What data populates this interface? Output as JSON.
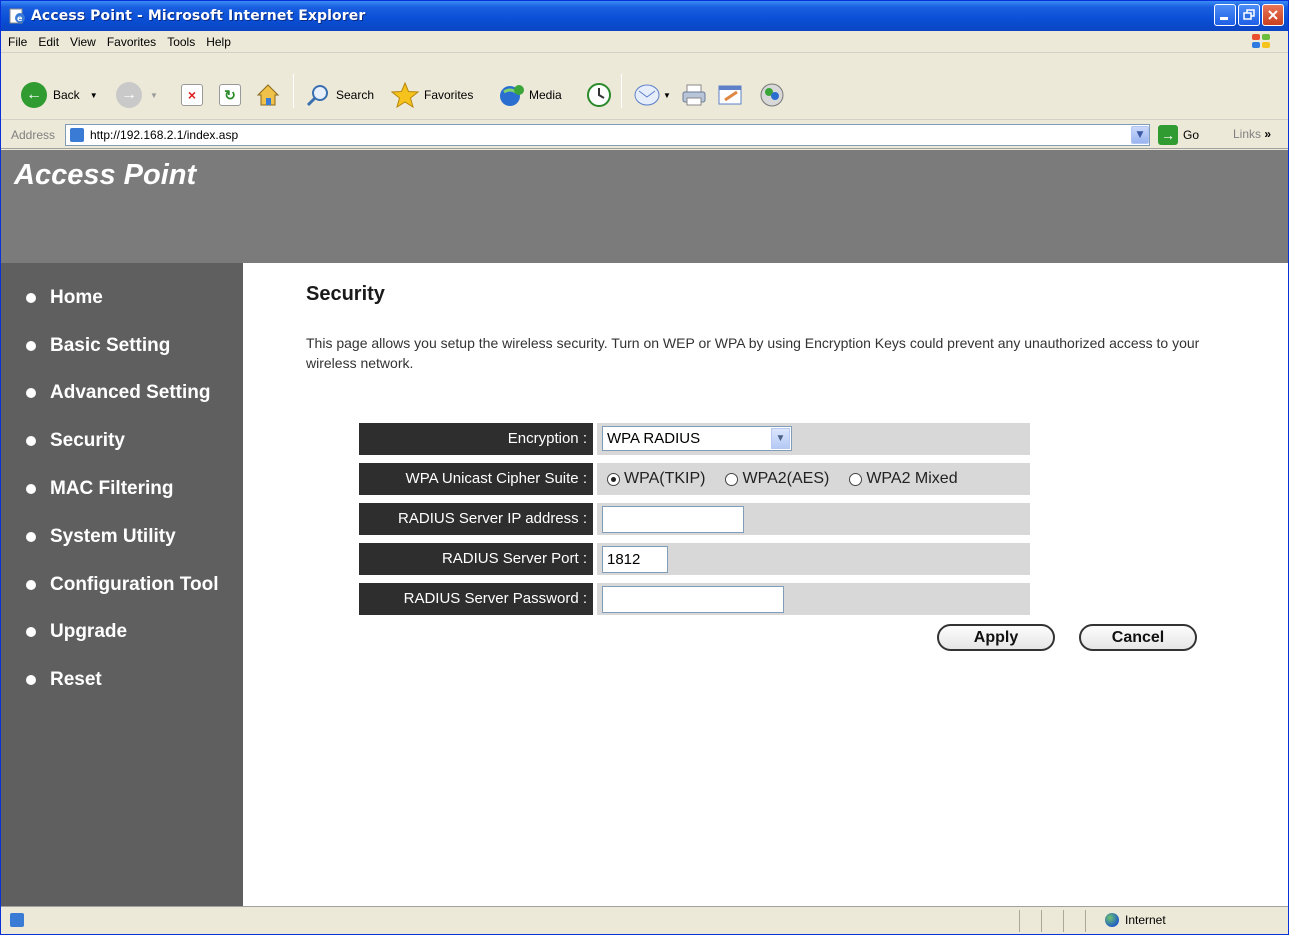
{
  "window": {
    "title": "Access Point - Microsoft Internet Explorer"
  },
  "menu": [
    "File",
    "Edit",
    "View",
    "Favorites",
    "Tools",
    "Help"
  ],
  "toolbar": {
    "back": "Back",
    "search": "Search",
    "favorites": "Favorites",
    "media": "Media"
  },
  "address": {
    "label": "Address",
    "url": "http://192.168.2.1/index.asp",
    "go": "Go",
    "links": "Links"
  },
  "page": {
    "brand": "Access Point",
    "nav": [
      "Home",
      "Basic Setting",
      "Advanced Setting",
      "Security",
      "MAC Filtering",
      "System Utility",
      "Configuration Tool",
      "Upgrade",
      "Reset"
    ],
    "heading": "Security",
    "description": "This page allows you setup the wireless security. Turn on WEP or WPA by using Encryption Keys could prevent any unauthorized access to your wireless network.",
    "form": {
      "encryption_label": "Encryption :",
      "encryption_value": "WPA RADIUS",
      "cipher_label": "WPA Unicast Cipher Suite :",
      "cipher_options": [
        "WPA(TKIP)",
        "WPA2(AES)",
        "WPA2 Mixed"
      ],
      "cipher_selected": "WPA(TKIP)",
      "radius_ip_label": "RADIUS Server IP address :",
      "radius_ip_value": "",
      "radius_port_label": "RADIUS Server Port :",
      "radius_port_value": "1812",
      "radius_password_label": "RADIUS Server Password :",
      "radius_password_value": ""
    },
    "buttons": {
      "apply": "Apply",
      "cancel": "Cancel"
    }
  },
  "status": {
    "zone": "Internet"
  },
  "colors": {
    "titlebar": "#0a4fd6",
    "banner": "#7b7b7b",
    "sidebar": "#5f5f5f",
    "label_bg": "#2e2e2e",
    "value_bg": "#d8d8d8"
  }
}
